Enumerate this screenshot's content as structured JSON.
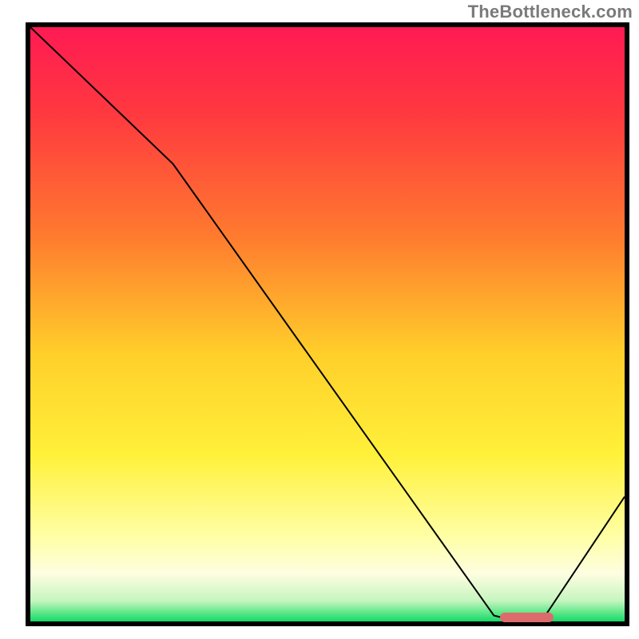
{
  "attribution": "TheBottleneck.com",
  "chart_data": {
    "type": "line",
    "title": "",
    "xlabel": "",
    "ylabel": "",
    "ylim": [
      0,
      100
    ],
    "xlim": [
      0,
      100
    ],
    "x": [
      0,
      24,
      78,
      82,
      86,
      100
    ],
    "values": [
      100,
      77,
      1,
      0,
      0,
      21
    ],
    "gradient_stops": [
      {
        "pos": 0.0,
        "color": "#ff1a53"
      },
      {
        "pos": 0.15,
        "color": "#ff3a3f"
      },
      {
        "pos": 0.35,
        "color": "#ff7a2f"
      },
      {
        "pos": 0.55,
        "color": "#ffcf2a"
      },
      {
        "pos": 0.72,
        "color": "#fff13a"
      },
      {
        "pos": 0.86,
        "color": "#ffffa8"
      },
      {
        "pos": 0.92,
        "color": "#fdfee0"
      },
      {
        "pos": 0.965,
        "color": "#c7f5c0"
      },
      {
        "pos": 0.985,
        "color": "#5fe889"
      },
      {
        "pos": 1.0,
        "color": "#14d86a"
      }
    ],
    "marker": {
      "x_start": 79,
      "x_end": 88,
      "y": 0,
      "color": "#dd6b6b"
    }
  }
}
